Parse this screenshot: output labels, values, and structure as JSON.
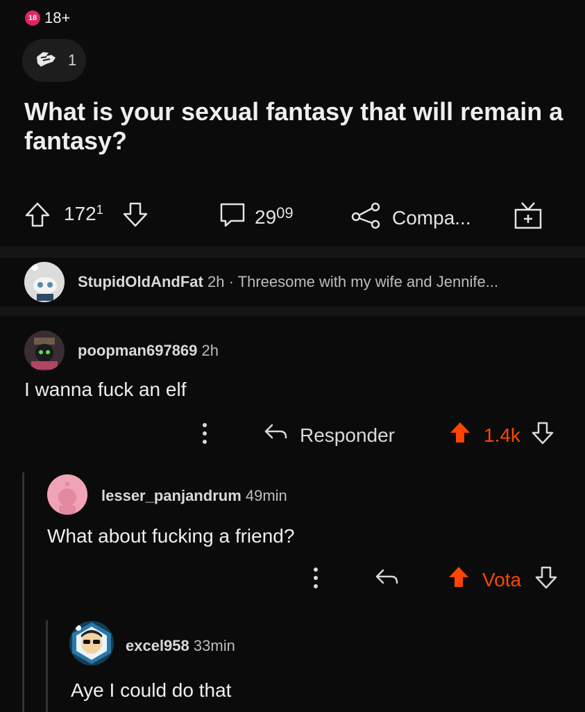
{
  "post": {
    "nsfw_label": "18+",
    "nsfw_icon_text": "18",
    "award_count": "1",
    "title": "What is your sexual fantasy that will remain a fantasy?",
    "vote_count": "172",
    "vote_count_sup": "1",
    "comment_count": "29",
    "comment_count_sup": "09",
    "share_label": "Compa..."
  },
  "top_comment": {
    "username": "StupidOldAndFat",
    "time": "2h",
    "separator": "·",
    "preview": "Threesome with my wife and Jennife..."
  },
  "comments": [
    {
      "username": "poopman697869",
      "time": "2h",
      "body": "I wanna fuck an elf",
      "reply_label": "Responder",
      "score": "1.4k"
    },
    {
      "username": "lesser_panjandrum",
      "time": "49min",
      "body": "What about fucking a friend?",
      "score": "Vota"
    },
    {
      "username": "excel958",
      "time": "33min",
      "body": "Aye I could do that"
    }
  ],
  "colors": {
    "background": "#0b0b0b",
    "upvote_active": "#ff4500",
    "nsfw": "#e0245e"
  },
  "icons": {
    "award": "fist-bump-icon",
    "upvote": "arrow-up-icon",
    "downvote": "arrow-down-icon",
    "comments": "comment-bubble-icon",
    "share": "share-nodes-icon",
    "gift": "gift-icon",
    "reply": "reply-arrow-icon",
    "more": "more-vertical-icon"
  }
}
